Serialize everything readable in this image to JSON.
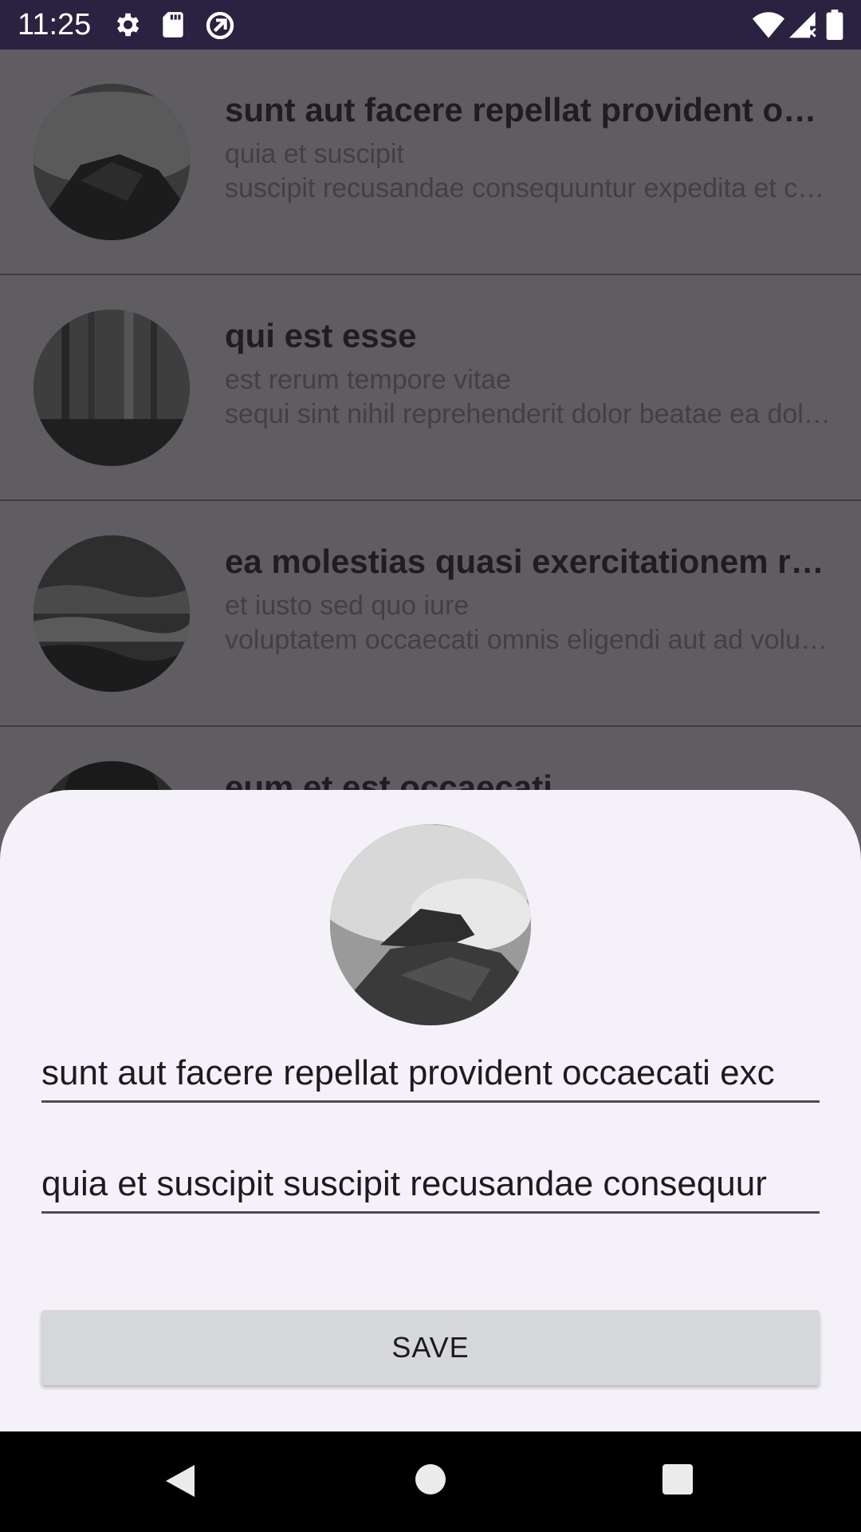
{
  "status_bar": {
    "time": "11:25",
    "left_icons": [
      "settings-icon",
      "sd-card-icon",
      "data-saver-icon"
    ],
    "right_icons": [
      "wifi-icon",
      "cell-signal-icon",
      "battery-icon"
    ]
  },
  "list": {
    "items": [
      {
        "title": "sunt aut facere repellat provident occaecati excepturi optio reprehenderit",
        "line1": "quia et suscipit",
        "line2": "suscipit recusandae consequuntur expedita et cum reprehenderit molestiae ut ut quas totam"
      },
      {
        "title": "qui est esse",
        "line1": "est rerum tempore vitae",
        "line2": "sequi sint nihil reprehenderit dolor beatae ea dolores neque fugiat blanditiis voluptate"
      },
      {
        "title": "ea molestias quasi exercitationem repellat qui ipsa sit aut",
        "line1": "et iusto sed quo iure",
        "line2": "voluptatem occaecati omnis eligendi aut ad voluptatem doloribus vel accusantium quis pariatur"
      },
      {
        "title": "eum et est occaecati",
        "line1": "",
        "line2": ""
      }
    ]
  },
  "sheet": {
    "title_value": "sunt aut facere repellat provident occaecati exc",
    "body_value": "quia et suscipit suscipit recusandae consequur",
    "save_label": "SAVE"
  },
  "nav": {
    "back": "back-icon",
    "home": "home-icon",
    "recents": "recents-icon"
  },
  "colors": {
    "status_bar": "#2b2140",
    "scrim_background": "#5f5c62",
    "sheet_background": "#f5f1f8",
    "button_background": "#d6d7d8"
  }
}
